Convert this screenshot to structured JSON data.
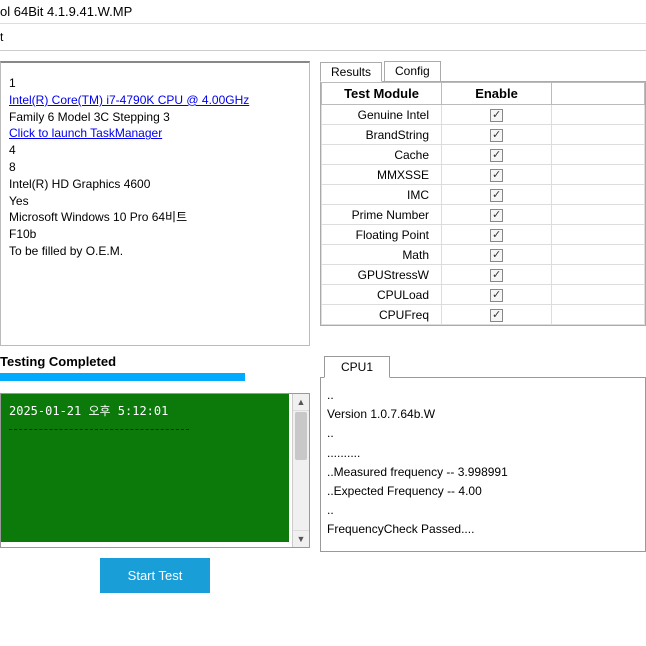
{
  "titlebar": "ol 64Bit 4.1.9.41.W.MP",
  "subbar": "t",
  "info": {
    "line1": "1",
    "cpu_link": "Intel(R) Core(TM) i7-4790K CPU @ 4.00GHz",
    "family": "Family 6 Model 3C Stepping 3",
    "taskmgr_link": "Click to launch TaskManager",
    "line4": "4",
    "line5": "8",
    "gpu": "Intel(R) HD Graphics 4600",
    "yes": "Yes",
    "os": "Microsoft Windows 10 Pro 64비트",
    "bios": "F10b",
    "oem": "To be filled by O.E.M."
  },
  "status_label": "Testing Completed",
  "console": {
    "date_line": "2025-01-21 오후 5:12:01"
  },
  "start_button": "Start Test",
  "tabs": {
    "results": "Results",
    "config": "Config"
  },
  "table": {
    "col_module": "Test Module",
    "col_enable": "Enable",
    "rows": [
      {
        "name": "Genuine Intel",
        "enabled": true
      },
      {
        "name": "BrandString",
        "enabled": true
      },
      {
        "name": "Cache",
        "enabled": true
      },
      {
        "name": "MMXSSE",
        "enabled": true
      },
      {
        "name": "IMC",
        "enabled": true
      },
      {
        "name": "Prime Number",
        "enabled": true
      },
      {
        "name": "Floating Point",
        "enabled": true
      },
      {
        "name": "Math",
        "enabled": true
      },
      {
        "name": "GPUStressW",
        "enabled": true
      },
      {
        "name": "CPULoad",
        "enabled": true
      },
      {
        "name": "CPUFreq",
        "enabled": true
      }
    ]
  },
  "cpu_tab": "CPU1",
  "cpu_output": {
    "l1": "..",
    "l2": "Version 1.0.7.64b.W",
    "l3": "..",
    "l4": "..........",
    "l5": "..Measured frequency -- 3.998991",
    "l6": "..Expected Frequency -- 4.00",
    "l7": "..",
    "l8": "",
    "l9": "FrequencyCheck Passed...."
  }
}
